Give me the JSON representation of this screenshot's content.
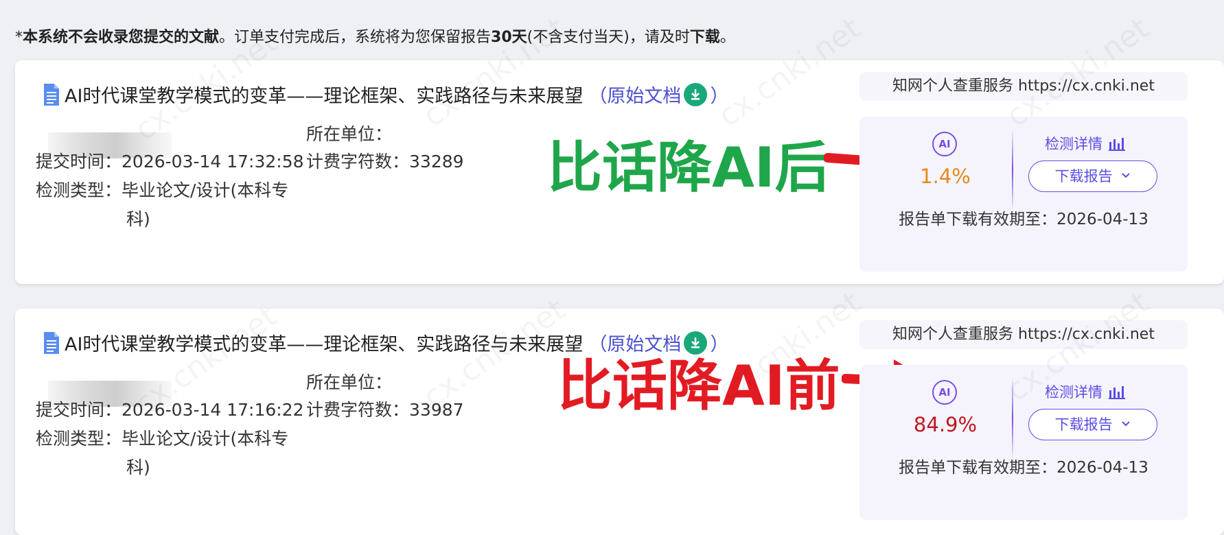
{
  "notice": {
    "part1": "*",
    "bold1": "本系统不会收录您提交的文献",
    "part2": "。订单支付完成后，系统将为您保留报告",
    "bold2": "30天",
    "part3": "(不含支付当天)，请及时",
    "bold3": "下载",
    "part4": "。"
  },
  "watermark": "cx.cnki.net",
  "records": [
    {
      "title": "AI时代课堂教学模式的变革——理论框架、实践路径与未来展望",
      "original_doc_open": "（原始文档",
      "original_doc_close": "）",
      "submit_label": "提交时间：",
      "submit_time": "2026-03-14 17:32:58",
      "type_label": "检测类型：",
      "type_line1": "毕业论文/设计(本科专",
      "type_line2": "科)",
      "unit_label": "所在单位：",
      "chars_label": "计费字符数：",
      "chars": "33289",
      "annotation": "比话降AI后",
      "annotation_color": "#1fa64a",
      "service": "知网个人查重服务  https://cx.cnki.net",
      "ai_icon_text": "AI",
      "percent": "1.4%",
      "percent_color": "#e48a1a",
      "detail_label": "检测详情",
      "download_label": "下载报告",
      "expiry": "报告单下载有效期至：2026-04-13"
    },
    {
      "title": "AI时代课堂教学模式的变革——理论框架、实践路径与未来展望",
      "original_doc_open": "（原始文档",
      "original_doc_close": "）",
      "submit_label": "提交时间：",
      "submit_time": "2026-03-14 17:16:22",
      "type_label": "检测类型：",
      "type_line1": "毕业论文/设计(本科专",
      "type_line2": "科)",
      "unit_label": "所在单位：",
      "chars_label": "计费字符数：",
      "chars": "33987",
      "annotation": "比话降AI前",
      "annotation_color": "#e21b23",
      "service": "知网个人查重服务  https://cx.cnki.net",
      "ai_icon_text": "AI",
      "percent": "84.9%",
      "percent_color": "#c0161f",
      "detail_label": "检测详情",
      "download_label": "下载报告",
      "expiry": "报告单下载有效期至：2026-04-13"
    }
  ]
}
